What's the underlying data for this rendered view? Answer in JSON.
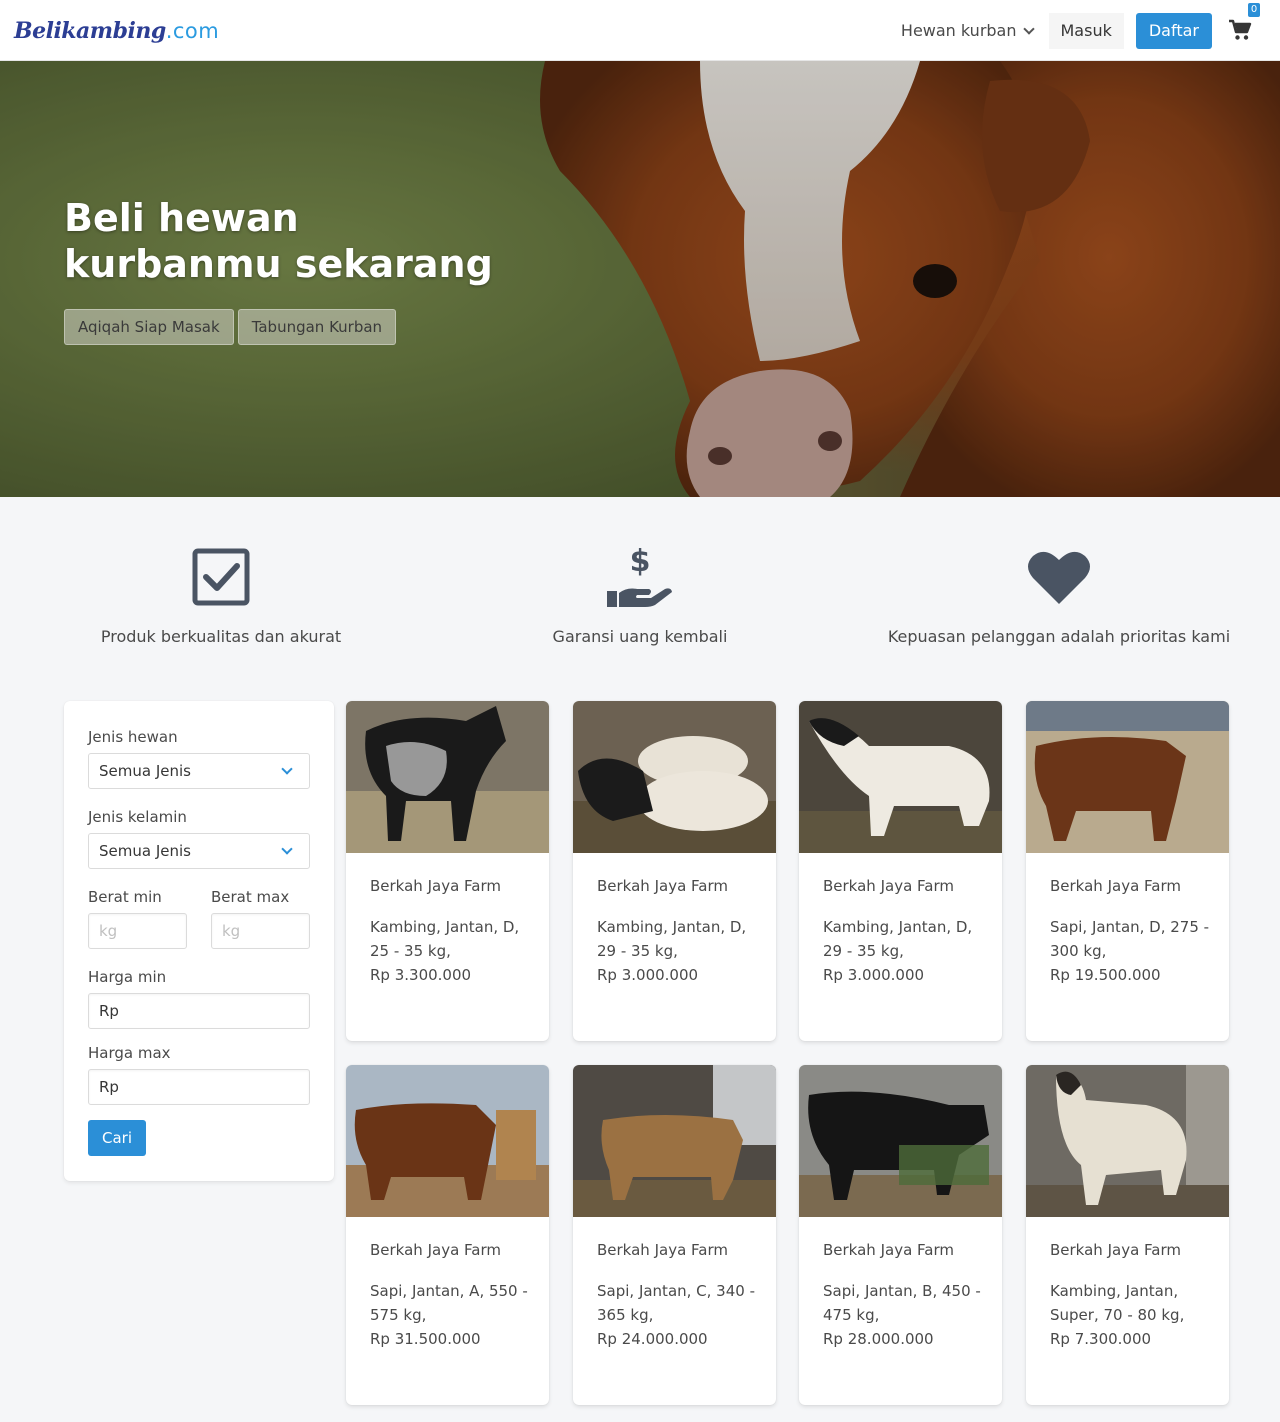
{
  "navbar": {
    "logo_part1": "Belikambing",
    "logo_part2": ".com",
    "menu_hewan": "Hewan kurban",
    "masuk": "Masuk",
    "daftar": "Daftar",
    "cart_count": "0"
  },
  "hero": {
    "title": "Beli hewan kurbanmu sekarang",
    "btn_aqiqah": "Aqiqah Siap Masak",
    "btn_tabungan": "Tabungan Kurban"
  },
  "features": [
    {
      "icon": "checkbox-icon",
      "text": "Produk berkualitas dan akurat"
    },
    {
      "icon": "money-hand-icon",
      "text": "Garansi uang kembali"
    },
    {
      "icon": "heart-icon",
      "text": "Kepuasan pelanggan adalah prioritas kami"
    }
  ],
  "filter": {
    "jenis_hewan_label": "Jenis hewan",
    "jenis_hewan_value": "Semua Jenis",
    "jenis_kelamin_label": "Jenis kelamin",
    "jenis_kelamin_value": "Semua Jenis",
    "berat_min_label": "Berat min",
    "berat_max_label": "Berat max",
    "berat_placeholder": "kg",
    "harga_min_label": "Harga min",
    "harga_min_value": "Rp",
    "harga_max_label": "Harga max",
    "harga_max_value": "Rp",
    "cari": "Cari"
  },
  "products": [
    {
      "farm": "Berkah Jaya Farm",
      "line1": "Kambing, Jantan, D,",
      "line2": "25 - 35 kg,",
      "price": "Rp 3.300.000"
    },
    {
      "farm": "Berkah Jaya Farm",
      "line1": "Kambing, Jantan, D,",
      "line2": "29 - 35 kg,",
      "price": "Rp 3.000.000"
    },
    {
      "farm": "Berkah Jaya Farm",
      "line1": "Kambing, Jantan, D,",
      "line2": "29 - 35 kg,",
      "price": "Rp 3.000.000"
    },
    {
      "farm": "Berkah Jaya Farm",
      "line1": "Sapi, Jantan, D, 275 -",
      "line2": "300 kg,",
      "price": "Rp 19.500.000"
    },
    {
      "farm": "Berkah Jaya Farm",
      "line1": "Sapi, Jantan, A, 550 -",
      "line2": "575 kg,",
      "price": "Rp 31.500.000"
    },
    {
      "farm": "Berkah Jaya Farm",
      "line1": "Sapi, Jantan, C, 340 -",
      "line2": "365 kg,",
      "price": "Rp 24.000.000"
    },
    {
      "farm": "Berkah Jaya Farm",
      "line1": "Sapi, Jantan, B, 450 -",
      "line2": "475 kg,",
      "price": "Rp 28.000.000"
    },
    {
      "farm": "Berkah Jaya Farm",
      "line1": "Kambing, Jantan,",
      "line2": "Super, 70 - 80 kg,",
      "price": "Rp 7.300.000"
    }
  ],
  "colors": {
    "primary": "#2b8fd7",
    "logo_dark": "#2c3e94",
    "icon": "#4a5463"
  }
}
